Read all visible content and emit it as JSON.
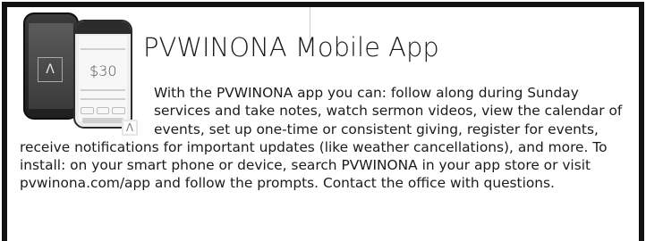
{
  "title": "PVWINONA Mobile App",
  "body": "With the PVWINONA app you can: follow along during Sunday services and take notes, watch sermon videos, view the calendar of events, set up one-time or consistent giving, register for events, receive notifications for important updates (like weather cancellations), and more. To install: on your smart phone or device, search PVWINONA in your app store or visit pvwinona.com/app and follow the prompts. Contact the office with questions.",
  "phone": {
    "amount": "$30",
    "logo_glyph": "Λ"
  },
  "badge": {
    "glyph": "Λ"
  }
}
